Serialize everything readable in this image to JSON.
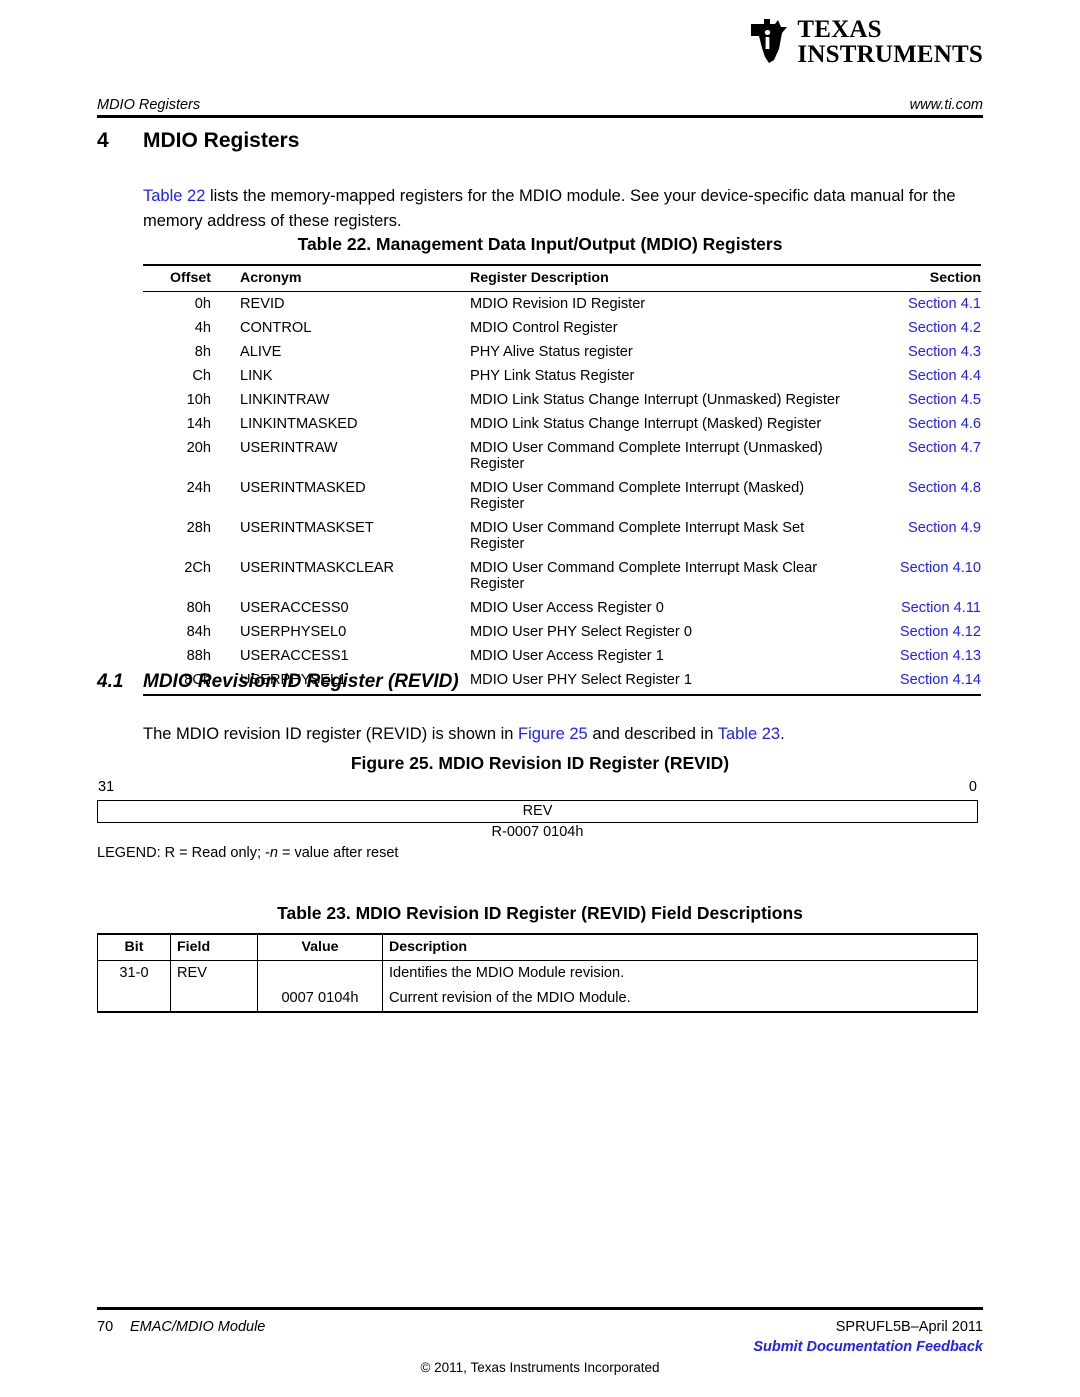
{
  "brand": {
    "logo_line1": "TEXAS",
    "logo_line2": "INSTRUMENTS",
    "logo_icon": "ti-texas-logo-icon"
  },
  "header": {
    "section_title": "MDIO Registers",
    "website": "www.ti.com"
  },
  "section4": {
    "number": "4",
    "title": "MDIO Registers",
    "paragraph_pre": "",
    "paragraph_link": "Table 22",
    "paragraph_post": " lists the memory-mapped registers for the MDIO module. See your device-specific data manual for the memory address of these registers."
  },
  "table22": {
    "caption": "Table 22. Management Data Input/Output (MDIO) Registers",
    "columns": [
      "Offset",
      "Acronym",
      "Register Description",
      "Section"
    ],
    "rows": [
      {
        "offset": "0h",
        "acronym": "REVID",
        "description": "MDIO Revision ID Register",
        "section": "Section 4.1"
      },
      {
        "offset": "4h",
        "acronym": "CONTROL",
        "description": "MDIO Control Register",
        "section": "Section 4.2"
      },
      {
        "offset": "8h",
        "acronym": "ALIVE",
        "description": "PHY Alive Status register",
        "section": "Section 4.3"
      },
      {
        "offset": "Ch",
        "acronym": "LINK",
        "description": "PHY Link Status Register",
        "section": "Section 4.4"
      },
      {
        "offset": "10h",
        "acronym": "LINKINTRAW",
        "description": "MDIO Link Status Change Interrupt (Unmasked) Register",
        "section": "Section 4.5"
      },
      {
        "offset": "14h",
        "acronym": "LINKINTMASKED",
        "description": "MDIO Link Status Change Interrupt (Masked) Register",
        "section": "Section 4.6"
      },
      {
        "offset": "20h",
        "acronym": "USERINTRAW",
        "description": "MDIO User Command Complete Interrupt (Unmasked) Register",
        "section": "Section 4.7"
      },
      {
        "offset": "24h",
        "acronym": "USERINTMASKED",
        "description": "MDIO User Command Complete Interrupt (Masked) Register",
        "section": "Section 4.8"
      },
      {
        "offset": "28h",
        "acronym": "USERINTMASKSET",
        "description": "MDIO User Command Complete Interrupt Mask Set Register",
        "section": "Section 4.9"
      },
      {
        "offset": "2Ch",
        "acronym": "USERINTMASKCLEAR",
        "description": "MDIO User Command Complete Interrupt Mask Clear Register",
        "section": "Section 4.10"
      },
      {
        "offset": "80h",
        "acronym": "USERACCESS0",
        "description": "MDIO User Access Register 0",
        "section": "Section 4.11"
      },
      {
        "offset": "84h",
        "acronym": "USERPHYSEL0",
        "description": "MDIO User PHY Select Register 0",
        "section": "Section 4.12"
      },
      {
        "offset": "88h",
        "acronym": "USERACCESS1",
        "description": "MDIO User Access Register 1",
        "section": "Section 4.13"
      },
      {
        "offset": "8Ch",
        "acronym": "USERPHYSEL1",
        "description": "MDIO User PHY Select Register 1",
        "section": "Section 4.14"
      }
    ]
  },
  "section41": {
    "number": "4.1",
    "title": "MDIO Revision ID Register (REVID)",
    "para_a": "The MDIO revision ID register (REVID) is shown in ",
    "link_figure": "Figure 25",
    "para_b": " and described in ",
    "link_table": "Table 23",
    "para_c": "."
  },
  "figure25": {
    "caption": "Figure 25. MDIO Revision ID Register (REVID)",
    "bit_high": "31",
    "bit_low": "0",
    "field_name": "REV",
    "reset_value": "R-0007 0104h",
    "legend_pre": "LEGEND: R = Read only; -",
    "legend_italic": "n",
    "legend_post": " = value after reset"
  },
  "table23": {
    "caption": "Table 23.  MDIO Revision ID Register (REVID) Field Descriptions",
    "columns": [
      "Bit",
      "Field",
      "Value",
      "Description"
    ],
    "rows": [
      {
        "bit": "31-0",
        "field": "REV",
        "value": "",
        "description": "Identifies the MDIO Module revision."
      },
      {
        "bit": "",
        "field": "",
        "value": "0007 0104h",
        "description": "Current revision of the MDIO Module."
      }
    ]
  },
  "footer": {
    "page_number": "70",
    "document_title": "EMAC/MDIO Module",
    "literature": "SPRUFL5B–April 2011",
    "feedback_link": "Submit Documentation Feedback",
    "copyright": "© 2011, Texas Instruments Incorporated"
  },
  "colors": {
    "link_blue": "#2222EE",
    "text_black": "#000000",
    "page_background": "#FFFFFF"
  }
}
